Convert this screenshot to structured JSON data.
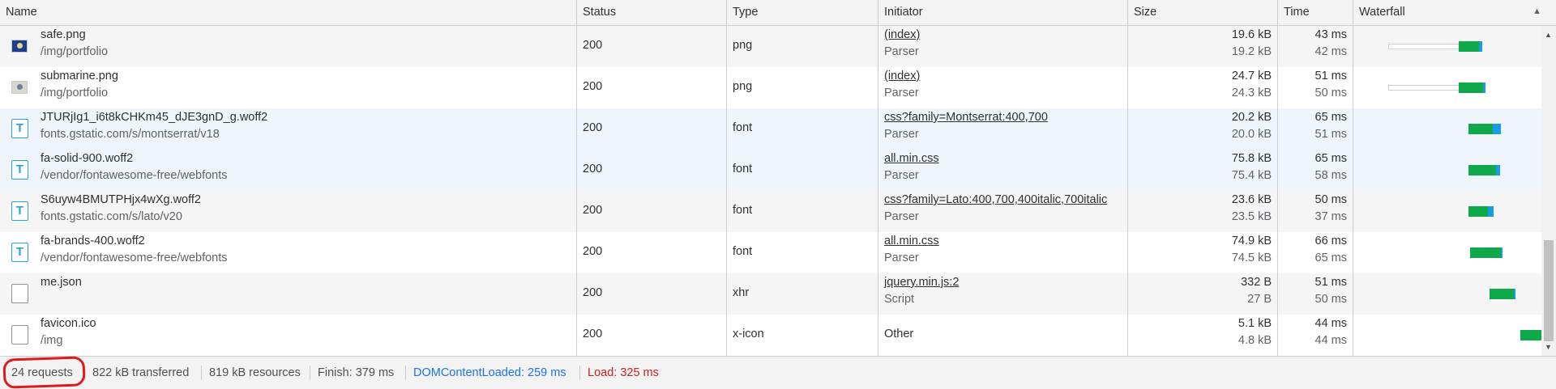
{
  "columns": {
    "name": "Name",
    "status": "Status",
    "type": "Type",
    "initiator": "Initiator",
    "size": "Size",
    "time": "Time",
    "waterfall": "Waterfall"
  },
  "sort_icon": "triangle-up",
  "rows": [
    {
      "icon": "image-icon",
      "name": "safe.png",
      "path": "/img/portfolio",
      "status": "200",
      "type": "png",
      "initiator": "(index)",
      "initiator_type": "Parser",
      "size_transferred": "19.6 kB",
      "size_resource": "19.2 kB",
      "time_total": "43 ms",
      "time_latency": "42 ms"
    },
    {
      "icon": "image-icon",
      "name": "submarine.png",
      "path": "/img/portfolio",
      "status": "200",
      "type": "png",
      "initiator": "(index)",
      "initiator_type": "Parser",
      "size_transferred": "24.7 kB",
      "size_resource": "24.3 kB",
      "time_total": "51 ms",
      "time_latency": "50 ms"
    },
    {
      "icon": "font-icon",
      "name": "JTURjIg1_i6t8kCHKm45_dJE3gnD_g.woff2",
      "path": "fonts.gstatic.com/s/montserrat/v18",
      "status": "200",
      "type": "font",
      "initiator": "css?family=Montserrat:400,700",
      "initiator_type": "Parser",
      "size_transferred": "20.2 kB",
      "size_resource": "20.0 kB",
      "time_total": "65 ms",
      "time_latency": "51 ms"
    },
    {
      "icon": "font-icon",
      "name": "fa-solid-900.woff2",
      "path": "/vendor/fontawesome-free/webfonts",
      "status": "200",
      "type": "font",
      "initiator": "all.min.css",
      "initiator_type": "Parser",
      "size_transferred": "75.8 kB",
      "size_resource": "75.4 kB",
      "time_total": "65 ms",
      "time_latency": "58 ms"
    },
    {
      "icon": "font-icon",
      "name": "S6uyw4BMUTPHjx4wXg.woff2",
      "path": "fonts.gstatic.com/s/lato/v20",
      "status": "200",
      "type": "font",
      "initiator": "css?family=Lato:400,700,400italic,700italic",
      "initiator_type": "Parser",
      "size_transferred": "23.6 kB",
      "size_resource": "23.5 kB",
      "time_total": "50 ms",
      "time_latency": "37 ms"
    },
    {
      "icon": "font-icon",
      "name": "fa-brands-400.woff2",
      "path": "/vendor/fontawesome-free/webfonts",
      "status": "200",
      "type": "font",
      "initiator": "all.min.css",
      "initiator_type": "Parser",
      "size_transferred": "74.9 kB",
      "size_resource": "74.5 kB",
      "time_total": "66 ms",
      "time_latency": "65 ms"
    },
    {
      "icon": "document-icon",
      "name": "me.json",
      "path": "",
      "status": "200",
      "type": "xhr",
      "initiator": "jquery.min.js:2",
      "initiator_type": "Script",
      "size_transferred": "332 B",
      "size_resource": "27 B",
      "time_total": "51 ms",
      "time_latency": "50 ms"
    },
    {
      "icon": "document-icon",
      "name": "favicon.ico",
      "path": "/img",
      "status": "200",
      "type": "x-icon",
      "initiator": "Other",
      "initiator_type": "",
      "size_transferred": "5.1 kB",
      "size_resource": "4.8 kB",
      "time_total": "44 ms",
      "time_latency": "44 ms"
    }
  ],
  "summary": {
    "requests": "24 requests",
    "transferred": "822 kB transferred",
    "resources": "819 kB resources",
    "finish": "Finish: 379 ms",
    "dom_content_loaded": "DOMContentLoaded: 259 ms",
    "load": "Load: 325 ms"
  },
  "colors": {
    "dom_content_loaded": "#1a73e8",
    "load": "#c5221f",
    "bar_download": "#0fa84a",
    "bar_content": "#1a9be6",
    "annotation_circle": "#e0191f"
  }
}
